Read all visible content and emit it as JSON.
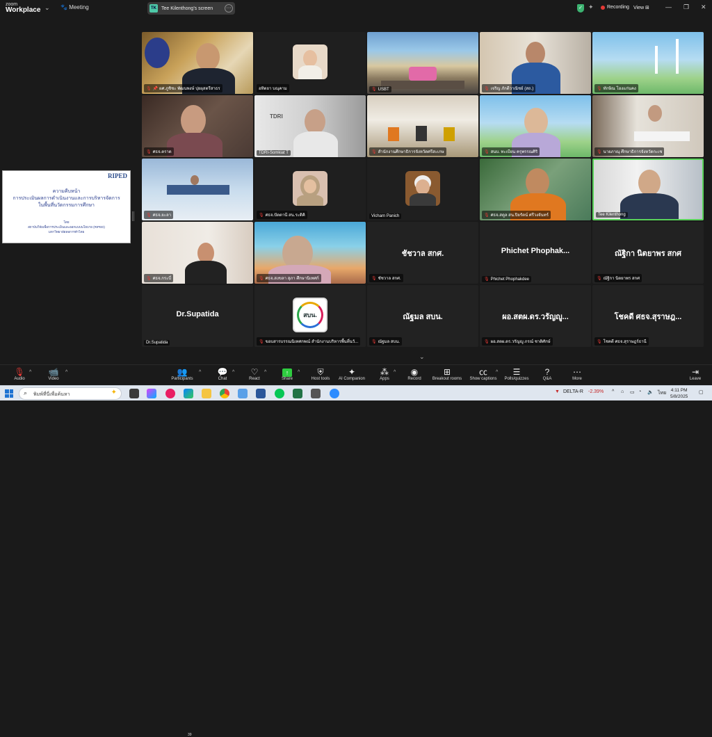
{
  "titlebar": {
    "brand_top": "zoom",
    "brand_bottom": "Workplace",
    "meeting_label": "Meeting",
    "screen_badge": "TK",
    "screen_label": "Tee Kilenthong's screen",
    "recording_label": "Recording",
    "view_label": "View"
  },
  "share": {
    "logo": "RIPED",
    "title_lines": [
      "ความคืบหน้า",
      "การประเมินผลการดำเนินงานและการบริหารจัดการ",
      "ในพื้นที่นวัตกรรมการศึกษา"
    ],
    "by_lines": [
      "โดย",
      "สถาบันวิจัยเพื่อการประเมินและออกแบบนโยบาย (RIPED)",
      "มหาวิทยาลัยหอการค้าไทย"
    ]
  },
  "participants": [
    {
      "name": "ผศ.ภูชิชะ พัฒนพงษ์ ปุยผุสตรีสาธร",
      "muted": true,
      "pinned": true,
      "display": ""
    },
    {
      "name": "อทิตยา บณุคาม",
      "muted": false,
      "display": ""
    },
    {
      "name": "USBT",
      "muted": true,
      "display": ""
    },
    {
      "name": "เจริญ ภักดีวาณิชย์ (สถ.)",
      "muted": true,
      "display": ""
    },
    {
      "name": "ทักษิณ โฮงแก่นคง",
      "muted": true,
      "display": ""
    },
    {
      "name": "ศธจ.ตราด",
      "muted": true,
      "display": ""
    },
    {
      "name": "TDRI-Somkiat T",
      "muted": false,
      "display": ""
    },
    {
      "name": "สำนักงานศึกษาธิการจังหวัดศรีสะเกษ",
      "muted": true,
      "display": ""
    },
    {
      "name": "สนบ. ทะเบียน ครุพรรณศิริ",
      "muted": true,
      "display": ""
    },
    {
      "name": "นายภาณุ ศึกษาธิการจังหวัดกะเช",
      "muted": true,
      "display": ""
    },
    {
      "name": "ศธจ.ยะลา",
      "muted": true,
      "display": ""
    },
    {
      "name": "ศธจ.ปัตตานี สน.ระดิคิ",
      "muted": true,
      "display": ""
    },
    {
      "name": "Vicharn Panich",
      "muted": false,
      "display": ""
    },
    {
      "name": "ศธจ.สตูล สน.ปิยรัตน์ ศรีวงจันทร์",
      "muted": true,
      "display": ""
    },
    {
      "name": "Tee Kilenthong",
      "muted": false,
      "display": ""
    },
    {
      "name": "ศธจ.กระบี่",
      "muted": true,
      "display": ""
    },
    {
      "name": "ศธจ.สงขลา สุภา ศึกษานิเทศก์",
      "muted": true,
      "display": ""
    },
    {
      "name": "ชัชวาล สกศ.",
      "muted": true,
      "display": "ชัชวาล สกศ."
    },
    {
      "name": "Phichet Phophakdee",
      "muted": true,
      "display": "Phichet Phophak..."
    },
    {
      "name": "ณัฐิกา นิตยาพร สกศ",
      "muted": true,
      "display": "ณัฐิกา นิตยาพร สกศ"
    },
    {
      "name": "Dr.Supatida",
      "muted": false,
      "display": "Dr.Supatida"
    },
    {
      "name": "ขอบสารบรรณนิเทศกพณ์ สำนักงานบริหารพื้นที่นวั...",
      "muted": true,
      "display": "สบน."
    },
    {
      "name": "ณัฐมล สบน.",
      "muted": true,
      "display": "ณัฐมล สบน."
    },
    {
      "name": "ผอ.สตผ.ดร.วรัญญู ภรณ์ ชาติศักษ์",
      "muted": true,
      "display": "ผอ.สตผ.ดร.วรัญญู..."
    },
    {
      "name": "โชคดี ศธจ.สุราษฎร์ธานี",
      "muted": true,
      "display": "โชคดี ศธจ.สุราษฎ..."
    }
  ],
  "toolbar": {
    "audio": "Audio",
    "video": "Video",
    "participants": "Participants",
    "participant_count": "39",
    "chat": "Chat",
    "react": "React",
    "share": "Share",
    "host_tools": "Host tools",
    "ai_companion": "AI Companion",
    "apps": "Apps",
    "record": "Record",
    "breakout": "Breakout rooms",
    "captions": "Show captions",
    "polls": "Polls/quizzes",
    "qa": "Q&A",
    "more": "More",
    "leave": "Leave"
  },
  "taskbar": {
    "search_placeholder": "พิมพ์ที่นี่เพื่อค้นหา",
    "stock_name": "DELTA-R",
    "stock_change": "-2.39%",
    "lang": "ไทย",
    "time": "4:11 PM",
    "date": "5/8/2025"
  },
  "colors": {
    "accent_green": "#5ad35a",
    "mute_red": "#e53935",
    "share_green": "#2ecc40"
  }
}
